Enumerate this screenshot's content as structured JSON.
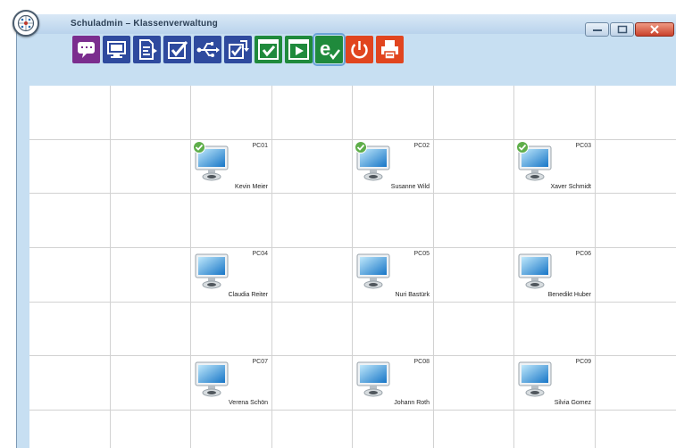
{
  "window": {
    "title": "Schuladmin – Klassenverwaltung"
  },
  "icons": {
    "logo": "network-logo-icon",
    "minimize": "minimize-icon",
    "maximize": "maximize-icon",
    "close": "close-icon"
  },
  "toolbar": [
    {
      "name": "message-button",
      "icon": "chat-bubble-icon",
      "color": "#7b2d8e"
    },
    {
      "name": "screen-view-button",
      "icon": "monitor-icon",
      "color": "#2e4a9e"
    },
    {
      "name": "send-document-button",
      "icon": "document-arrow-icon",
      "color": "#2e4a9e"
    },
    {
      "name": "assign-task-button",
      "icon": "checkbox-icon",
      "color": "#2e4a9e"
    },
    {
      "name": "usb-button",
      "icon": "usb-icon",
      "color": "#2e4a9e"
    },
    {
      "name": "collect-task-button",
      "icon": "checkbox-return-icon",
      "color": "#2e4a9e"
    },
    {
      "name": "exam-window-button",
      "icon": "window-check-icon",
      "color": "#1f8a3c"
    },
    {
      "name": "presentation-button",
      "icon": "window-play-icon",
      "color": "#1f8a3c"
    },
    {
      "name": "internet-allow-button",
      "icon": "internet-explorer-check-icon",
      "color": "#1f8a3c"
    },
    {
      "name": "shutdown-button",
      "icon": "power-icon",
      "color": "#e1451f"
    },
    {
      "name": "print-button",
      "icon": "printer-icon",
      "color": "#e1451f"
    }
  ],
  "computers": [
    {
      "id": "PC01",
      "user": "Kevin Meier",
      "status": "online"
    },
    {
      "id": "PC02",
      "user": "Susanne Wild",
      "status": "online"
    },
    {
      "id": "PC03",
      "user": "Xaver Schmidt",
      "status": "online"
    },
    {
      "id": "PC04",
      "user": "Claudia Reiter",
      "status": ""
    },
    {
      "id": "PC05",
      "user": "Nuri Bastürk",
      "status": ""
    },
    {
      "id": "PC06",
      "user": "Benedikt Huber",
      "status": ""
    },
    {
      "id": "PC07",
      "user": "Verena Schön",
      "status": ""
    },
    {
      "id": "PC08",
      "user": "Johann Roth",
      "status": ""
    },
    {
      "id": "PC09",
      "user": "Silvia Gomez",
      "status": ""
    }
  ],
  "colors": {
    "online": "#5fae4a",
    "window": "#c7dff2",
    "grid_line": "#d2d2d2"
  }
}
